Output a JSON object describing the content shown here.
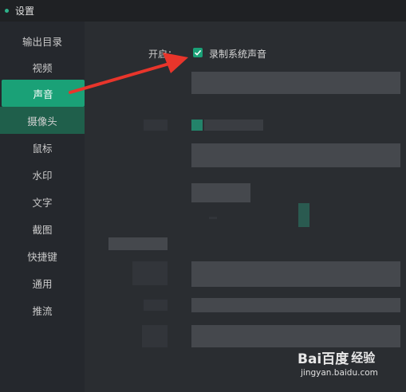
{
  "window": {
    "title": "设置"
  },
  "sidebar": {
    "items": [
      {
        "label": "输出目录"
      },
      {
        "label": "视频"
      },
      {
        "label": "声音"
      },
      {
        "label": "摄像头"
      },
      {
        "label": "鼠标"
      },
      {
        "label": "水印"
      },
      {
        "label": "文字"
      },
      {
        "label": "截图"
      },
      {
        "label": "快捷键"
      },
      {
        "label": "通用"
      },
      {
        "label": "推流"
      }
    ],
    "active_label": "声音"
  },
  "sound": {
    "open_label": "开启：",
    "record_system_audio": {
      "label": "录制系统声音",
      "checked": true
    }
  },
  "colors": {
    "accent": "#1aa177",
    "arrow": "#e8352b",
    "background": "#2a2d31"
  },
  "watermark": {
    "logo": "Bai百度",
    "suffix": "经验",
    "url": "jingyan.baidu.com"
  }
}
